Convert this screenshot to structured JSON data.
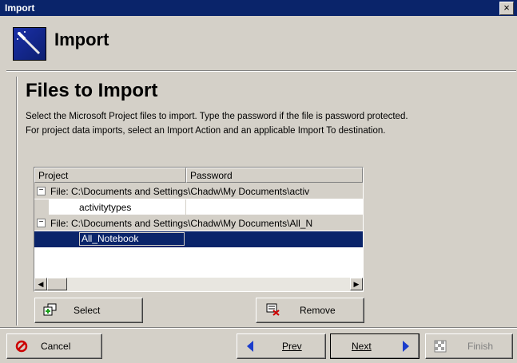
{
  "window": {
    "title": "Import",
    "close_glyph": "×"
  },
  "header": {
    "title": "Import",
    "icon": "magic-wand-icon"
  },
  "section": {
    "title": "Files to Import",
    "description_line1": "Select the Microsoft Project files to import.  Type the password if the file is password protected.",
    "description_line2": "For project data imports, select an Import Action and an applicable Import To destination."
  },
  "grid": {
    "columns": [
      "Project",
      "Password"
    ],
    "groups": [
      {
        "toggle": "−",
        "label": "File: C:\\Documents and Settings\\Chadw\\My Documents\\activ",
        "rows": [
          {
            "project": "activitytypes",
            "password": ""
          }
        ]
      },
      {
        "toggle": "−",
        "label": "File: C:\\Documents and Settings\\Chadw\\My Documents\\All_N",
        "rows": [
          {
            "project": "All_Notebook",
            "password": "",
            "selected": true
          }
        ]
      }
    ],
    "scroll_left_glyph": "◀",
    "scroll_right_glyph": "▶"
  },
  "buttons": {
    "select": "Select",
    "remove": "Remove",
    "cancel": "Cancel",
    "prev": "Prev",
    "next": "Next",
    "finish": "Finish"
  },
  "colors": {
    "titlebar": "#0a246a",
    "selection": "#0a246a",
    "window_bg": "#d4d0c8",
    "cancel_icon": "#cc0000",
    "nav_arrow": "#1a3ccc",
    "add_icon": "#1aa01a"
  }
}
